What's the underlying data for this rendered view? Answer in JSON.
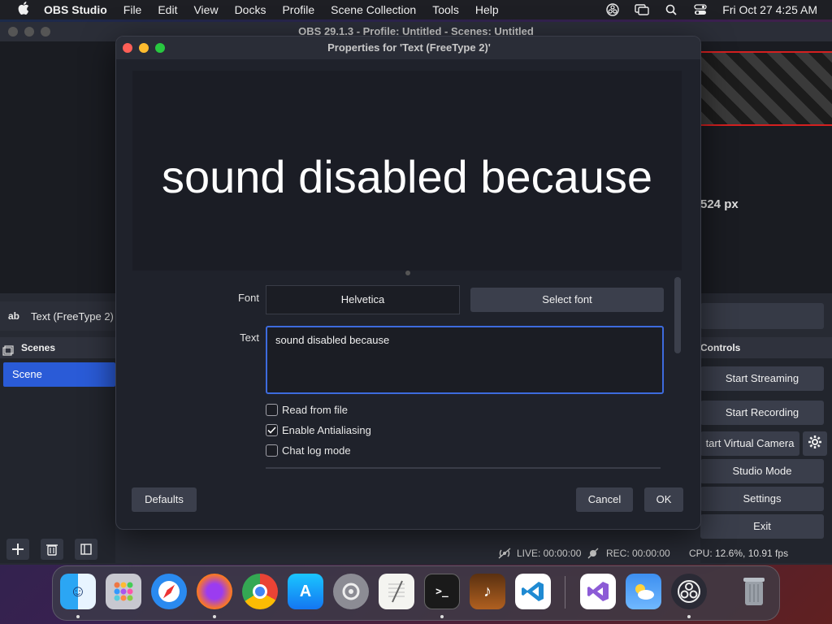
{
  "menubar": {
    "app_name": "OBS Studio",
    "items": [
      "File",
      "Edit",
      "View",
      "Docks",
      "Profile",
      "Scene Collection",
      "Tools",
      "Help"
    ],
    "datetime": "Fri Oct 27  4:25 AM"
  },
  "main_window": {
    "title": "OBS 29.1.3 - Profile: Untitled - Scenes: Untitled",
    "size_readout": "524 px",
    "source_icon": "ab",
    "source_name": "Text (FreeType 2)",
    "scenes_header": "Scenes",
    "scenes": [
      "Scene"
    ],
    "controls_header": "Controls",
    "controls": {
      "start_streaming": "Start Streaming",
      "start_recording": "Start Recording",
      "start_virtual_camera": "tart Virtual Camera",
      "studio_mode": "Studio Mode",
      "settings": "Settings",
      "exit": "Exit"
    },
    "status": {
      "live": "LIVE: 00:00:00",
      "rec": "REC: 00:00:00",
      "cpu": "CPU: 12.6%, 10.91 fps"
    }
  },
  "dialog": {
    "title": "Properties for 'Text (FreeType 2)'",
    "preview_text": "sound disabled because",
    "font_label": "Font",
    "font_value": "Helvetica",
    "select_font": "Select font",
    "text_label": "Text",
    "text_value": "sound disabled because",
    "checkboxes": [
      {
        "label": "Read from file",
        "checked": false
      },
      {
        "label": "Enable Antialiasing",
        "checked": true
      },
      {
        "label": "Chat log mode",
        "checked": false
      }
    ],
    "defaults": "Defaults",
    "cancel": "Cancel",
    "ok": "OK"
  },
  "colors": {
    "accent": "#2a5bd7",
    "close": "#ff5f57",
    "minimize": "#febc2e",
    "maximize": "#28c840"
  },
  "dock": {
    "icons": [
      "finder-icon",
      "launchpad-icon",
      "safari-icon",
      "firefox-icon",
      "chrome-icon",
      "app-store-icon",
      "system-settings-icon",
      "textedit-icon",
      "terminal-icon",
      "garageband-icon",
      "vscode-icon",
      "visual-studio-icon",
      "weather-icon",
      "obs-icon",
      "trash-icon"
    ]
  }
}
